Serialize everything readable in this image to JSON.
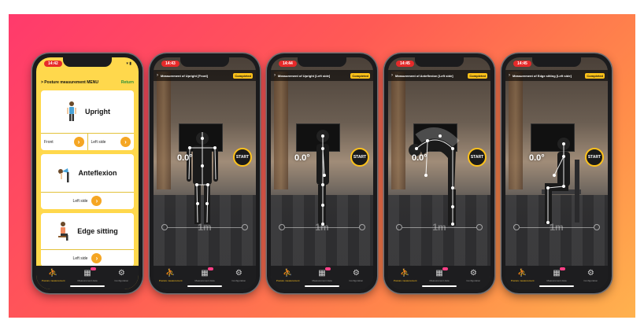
{
  "colors": {
    "accent": "#ffc21a",
    "menu_bg": "#ffd84c",
    "go_button": "#f5a623",
    "return_link": "#2a8f3a"
  },
  "menu_phone": {
    "time": "14:42",
    "header_title": "> Posture measurement MENU",
    "return_label": "Return",
    "cards": [
      {
        "title": "Upright",
        "left_option": "Front",
        "right_option": "Left side"
      },
      {
        "title": "Anteflexion",
        "option": "Left side"
      },
      {
        "title": "Edge sitting",
        "option": "Left side"
      }
    ]
  },
  "tabbar": {
    "tabs": [
      {
        "label": "Posture measurement",
        "icon": "running-figure-icon"
      },
      {
        "label": "Measurement data",
        "icon": "grid-icon"
      },
      {
        "label": "Configuration",
        "icon": "gear-icon"
      }
    ]
  },
  "camera_phones": [
    {
      "time": "14:43",
      "title": "Measurement of Upright [Front]",
      "status": "Completed",
      "angle": "0.0°",
      "start_label": "START",
      "distance": "1m"
    },
    {
      "time": "14:44",
      "title": "Measurement of Upright [Left side]",
      "status": "Completed",
      "angle": "0.0°",
      "start_label": "START",
      "distance": "1m"
    },
    {
      "time": "14:45",
      "title": "Measurement of Anteflexion [Left side]",
      "status": "Completed",
      "angle": "0.0°",
      "start_label": "START",
      "distance": "1m"
    },
    {
      "time": "14:45",
      "title": "Measurement of Edge sitting [Left side]",
      "status": "Completed",
      "angle": "0.0°",
      "start_label": "START",
      "distance": "1m"
    }
  ]
}
